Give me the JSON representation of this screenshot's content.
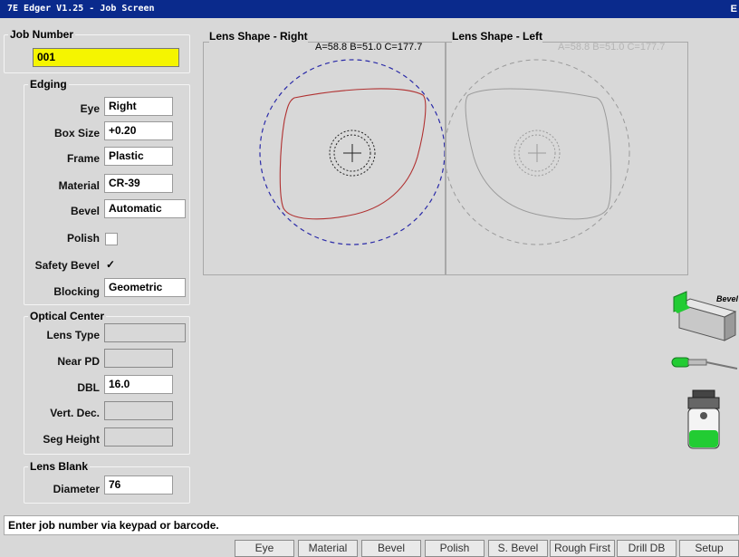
{
  "window": {
    "title": "7E Edger V1.25 - Job Screen",
    "corner_label": "E"
  },
  "job": {
    "legend": "Job Number",
    "value": "001"
  },
  "edging": {
    "legend": "Edging",
    "eye_label": "Eye",
    "eye_value": "Right",
    "box_size_label": "Box Size",
    "box_size_value": "+0.20",
    "frame_label": "Frame",
    "frame_value": "Plastic",
    "material_label": "Material",
    "material_value": "CR-39",
    "bevel_label": "Bevel",
    "bevel_value": "Automatic",
    "polish_label": "Polish",
    "polish_checked": false,
    "safety_bevel_label": "Safety Bevel",
    "safety_bevel_mark": "✓",
    "blocking_label": "Blocking",
    "blocking_value": "Geometric"
  },
  "optical_center": {
    "legend": "Optical Center",
    "lens_type_label": "Lens Type",
    "lens_type_value": "",
    "near_pd_label": "Near PD",
    "near_pd_value": "",
    "dbl_label": "DBL",
    "dbl_value": "16.0",
    "vert_dec_label": "Vert. Dec.",
    "vert_dec_value": "",
    "seg_height_label": "Seg Height",
    "seg_height_value": ""
  },
  "lens_blank": {
    "legend": "Lens Blank",
    "diameter_label": "Diameter",
    "diameter_value": "76"
  },
  "right_panel": {
    "title": "Lens Shape - Right",
    "values": "A=58.8 B=51.0 C=177.7"
  },
  "left_panel": {
    "title": "Lens Shape - Left",
    "values": "A=58.8 B=51.0 C=177.7"
  },
  "tools": {
    "bevel_label": "Bevel"
  },
  "status_message": "Enter job number via keypad or barcode.",
  "buttons": [
    "Eye",
    "Material",
    "Bevel",
    "Polish",
    "S. Bevel",
    "Rough First",
    "Drill DB",
    "Setup"
  ],
  "colors": {
    "title_bar": "#0a2a8c",
    "job_field": "#f5f500",
    "lens_shape_right": "#b03030",
    "blank_outline": "#2a2aa8",
    "tool_green": "#22cc33"
  }
}
